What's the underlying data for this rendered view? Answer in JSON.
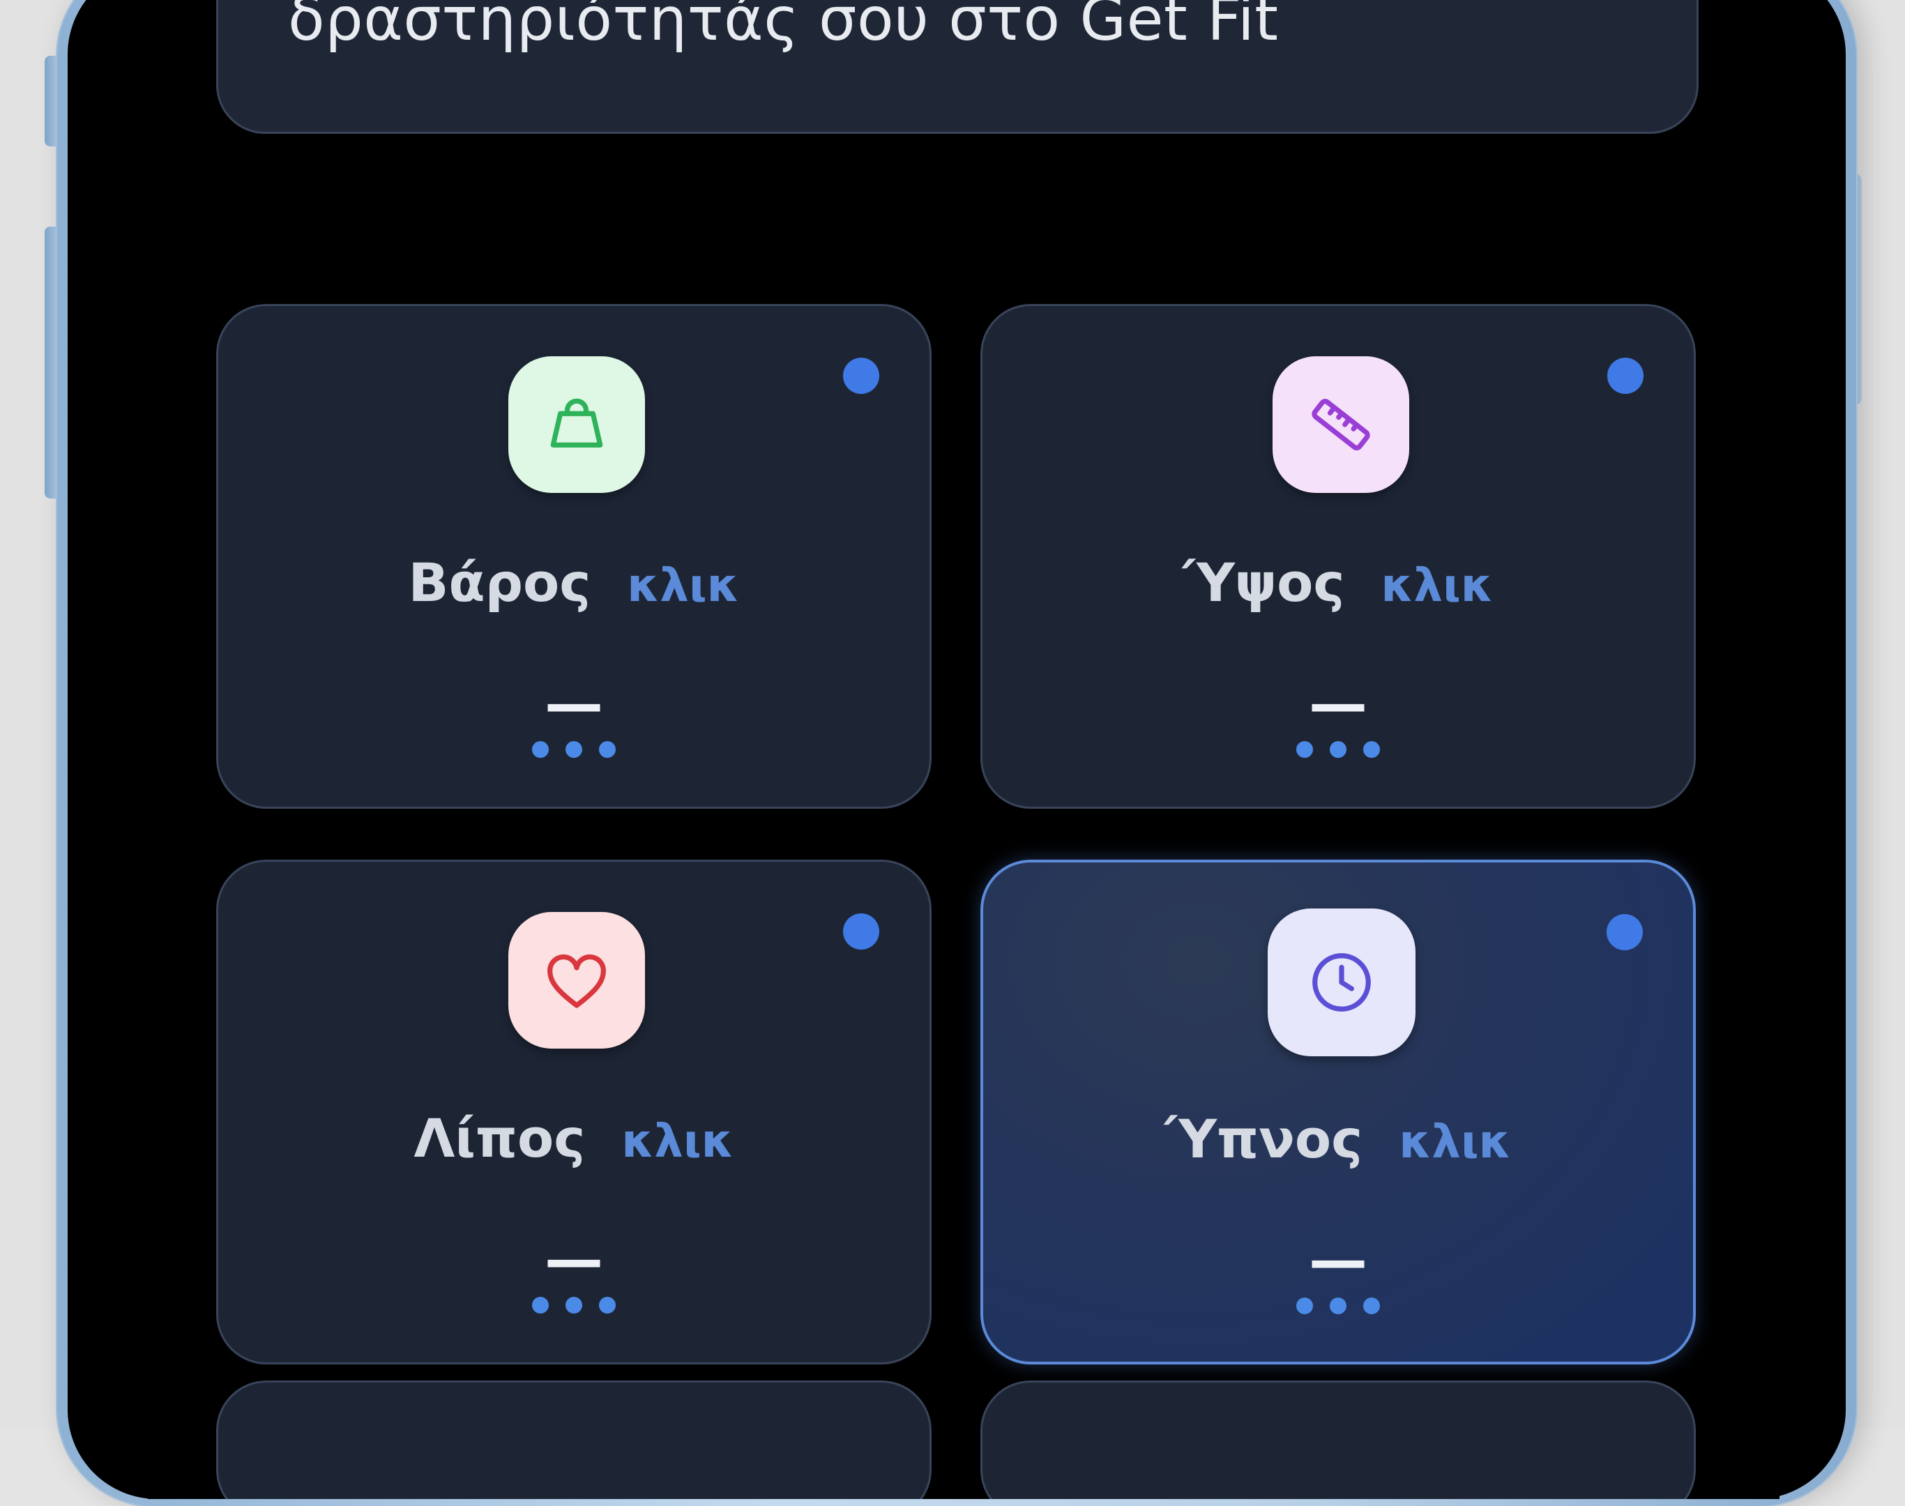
{
  "info_card": {
    "text": "δραστηριότητάς σου στο Get Fit"
  },
  "metrics": [
    {
      "label": "Βάρος",
      "action": "κλικ",
      "value": "—",
      "icon": "weight-icon",
      "icon_bg": "#dff8e6",
      "icon_color": "#2fb35a"
    },
    {
      "label": "Ύψος",
      "action": "κλικ",
      "value": "—",
      "icon": "ruler-icon",
      "icon_bg": "#f6e1fb",
      "icon_color": "#9a3fd6"
    },
    {
      "label": "Λίπος",
      "action": "κλικ",
      "value": "—",
      "icon": "heart-icon",
      "icon_bg": "#fde0e1",
      "icon_color": "#d9363e"
    },
    {
      "label": "Ύπνος",
      "action": "κλικ",
      "value": "—",
      "icon": "clock-icon",
      "icon_bg": "#e6e7fb",
      "icon_color": "#5b4fd6",
      "selected": true
    }
  ],
  "colors": {
    "background": "#000000",
    "card": "#1d2535",
    "card_border": "#39445a",
    "accent": "#3f7ae6",
    "selected_border": "#5c8ad8"
  }
}
